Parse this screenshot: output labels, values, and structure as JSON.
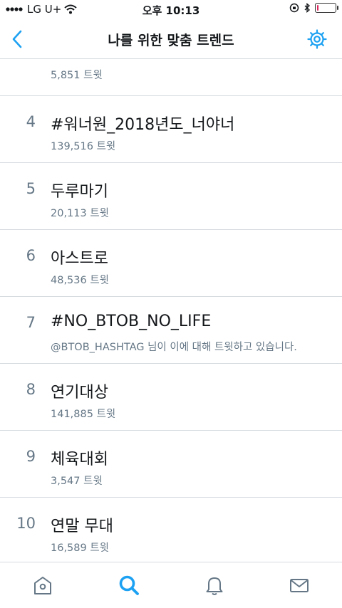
{
  "status_bar": {
    "carrier": "LG U+",
    "time": "오후 10:13",
    "battery_level": 0.1
  },
  "nav": {
    "title": "나를 위한 맞춤 트렌드",
    "back_icon": "chevron-left-icon",
    "settings_icon": "gear-icon"
  },
  "partial_trend": {
    "name": "",
    "meta": "5,851 트윗"
  },
  "trends": [
    {
      "rank": "4",
      "name": "#워너원_2018년도_너야너",
      "meta": "139,516 트윗"
    },
    {
      "rank": "5",
      "name": "두루마기",
      "meta": "20,113 트윗"
    },
    {
      "rank": "6",
      "name": "아스트로",
      "meta": "48,536 트윗"
    },
    {
      "rank": "7",
      "name": "#NO_BTOB_NO_LIFE",
      "meta": "@BTOB_HASHTAG 님이 이에 대해 트윗하고 있습니다."
    },
    {
      "rank": "8",
      "name": "연기대상",
      "meta": "141,885 트윗"
    },
    {
      "rank": "9",
      "name": "체육대회",
      "meta": "3,547 트윗"
    },
    {
      "rank": "10",
      "name": "연말 무대",
      "meta": "16,589 트윗"
    }
  ],
  "tabs": [
    {
      "icon": "home-icon",
      "active": false
    },
    {
      "icon": "search-icon",
      "active": true
    },
    {
      "icon": "bell-icon",
      "active": false
    },
    {
      "icon": "mail-icon",
      "active": false
    }
  ],
  "colors": {
    "accent": "#1da1f2",
    "secondary_text": "#657786",
    "divider": "#d6dbe0",
    "icon_inactive": "#657786"
  }
}
